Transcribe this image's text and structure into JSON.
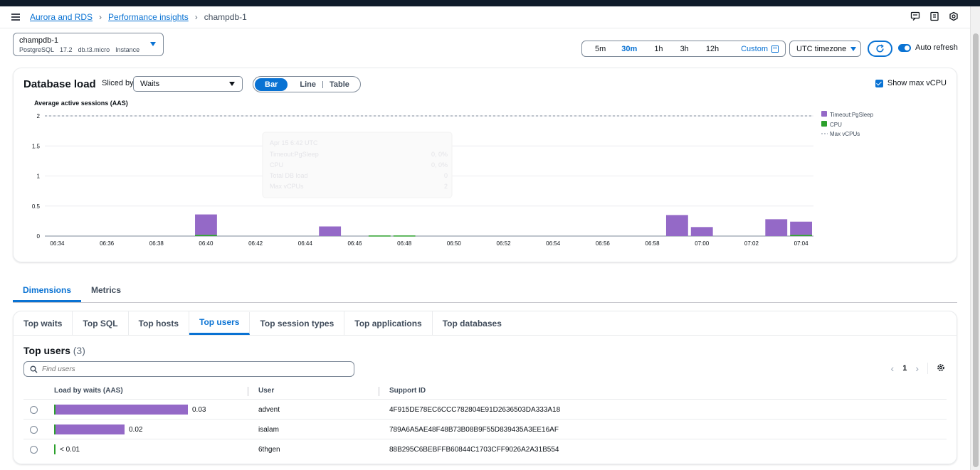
{
  "breadcrumb": {
    "items": [
      "Aurora and RDS",
      "Performance insights"
    ],
    "current": "champdb-1"
  },
  "instance": {
    "name": "champdb-1",
    "engine": "PostgreSQL",
    "version": "17.2",
    "class": "db.t3.micro",
    "role": "Instance"
  },
  "time_range": {
    "options": [
      "5m",
      "30m",
      "1h",
      "3h",
      "12h"
    ],
    "selected": "30m",
    "custom_label": "Custom"
  },
  "timezone": {
    "label": "UTC timezone"
  },
  "auto_refresh": {
    "label": "Auto refresh",
    "enabled": true
  },
  "load_panel": {
    "title": "Database load",
    "sliced_by_label": "Sliced by",
    "sliced_by_value": "Waits",
    "views": [
      "Bar",
      "Line",
      "Table"
    ],
    "active_view": "Bar",
    "show_max_vcpu_label": "Show max vCPU",
    "show_max_vcpu": true,
    "tooltip": {
      "time": "Apr 15 6:42 UTC",
      "rows": [
        {
          "label": "Timeout:PgSleep",
          "value": "0, 0%"
        },
        {
          "label": "CPU",
          "value": "0, 0%"
        },
        {
          "label": "Total DB load",
          "value": "0"
        },
        {
          "label": "Max vCPUs",
          "value": "2"
        }
      ]
    }
  },
  "chart_data": {
    "type": "bar",
    "ylabel": "Average active sessions (AAS)",
    "ylim": [
      0,
      2
    ],
    "yticks": [
      "0",
      "0.5",
      "1",
      "1.5",
      "2"
    ],
    "x": [
      "06:34",
      "06:35",
      "06:36",
      "06:37",
      "06:38",
      "06:39",
      "06:40",
      "06:41",
      "06:42",
      "06:43",
      "06:44",
      "06:45",
      "06:46",
      "06:47",
      "06:48",
      "06:49",
      "06:50",
      "06:51",
      "06:52",
      "06:53",
      "06:54",
      "06:55",
      "06:56",
      "06:57",
      "06:58",
      "06:59",
      "07:00",
      "07:01",
      "07:02",
      "07:03",
      "07:04"
    ],
    "xticks": [
      "06:34",
      "06:36",
      "06:38",
      "06:40",
      "06:42",
      "06:44",
      "06:46",
      "06:48",
      "06:50",
      "06:52",
      "06:54",
      "06:56",
      "06:58",
      "07:00",
      "07:02",
      "07:04"
    ],
    "series": [
      {
        "name": "Timeout:PgSleep",
        "color": "#9469c7",
        "values": [
          0,
          0,
          0,
          0,
          0,
          0,
          0.34,
          0,
          0,
          0,
          0,
          0.16,
          0,
          0,
          0,
          0,
          0,
          0,
          0,
          0,
          0,
          0,
          0,
          0,
          0,
          0.35,
          0.15,
          0,
          0,
          0.28,
          0.22
        ]
      },
      {
        "name": "CPU",
        "color": "#2ca02c",
        "values": [
          0,
          0,
          0,
          0,
          0,
          0,
          0.02,
          0,
          0,
          0,
          0,
          0,
          0,
          0.01,
          0.01,
          0,
          0,
          0,
          0,
          0,
          0,
          0,
          0,
          0,
          0,
          0,
          0,
          0,
          0,
          0,
          0.02
        ]
      }
    ],
    "max_vcpu": {
      "name": "Max vCPUs",
      "value": 2
    },
    "legend_position": "right"
  },
  "tabs": {
    "items": [
      "Dimensions",
      "Metrics"
    ],
    "active": "Dimensions"
  },
  "sub_tabs": {
    "items": [
      "Top waits",
      "Top SQL",
      "Top hosts",
      "Top users",
      "Top session types",
      "Top applications",
      "Top databases"
    ],
    "active": "Top users"
  },
  "top_users": {
    "title": "Top users",
    "count": "(3)",
    "search_placeholder": "Find users",
    "page": "1",
    "columns": [
      "Load by waits (AAS)",
      "User",
      "Support ID"
    ],
    "rows": [
      {
        "load_label": "0.03",
        "load_fraction": 1.0,
        "user": "advent",
        "support_id": "4F915DE78EC6CCC782804E91D2636503DA333A18"
      },
      {
        "load_label": "0.02",
        "load_fraction": 0.52,
        "user": "isalam",
        "support_id": "789A6A5AE48F48B73B08B9F55D839435A3EE16AF"
      },
      {
        "load_label": "< 0.01",
        "load_fraction": 0.0,
        "user": "6thgen",
        "support_id": "88B295C6BEBFFB60844C1703CFF9026A2A31B554"
      }
    ]
  }
}
